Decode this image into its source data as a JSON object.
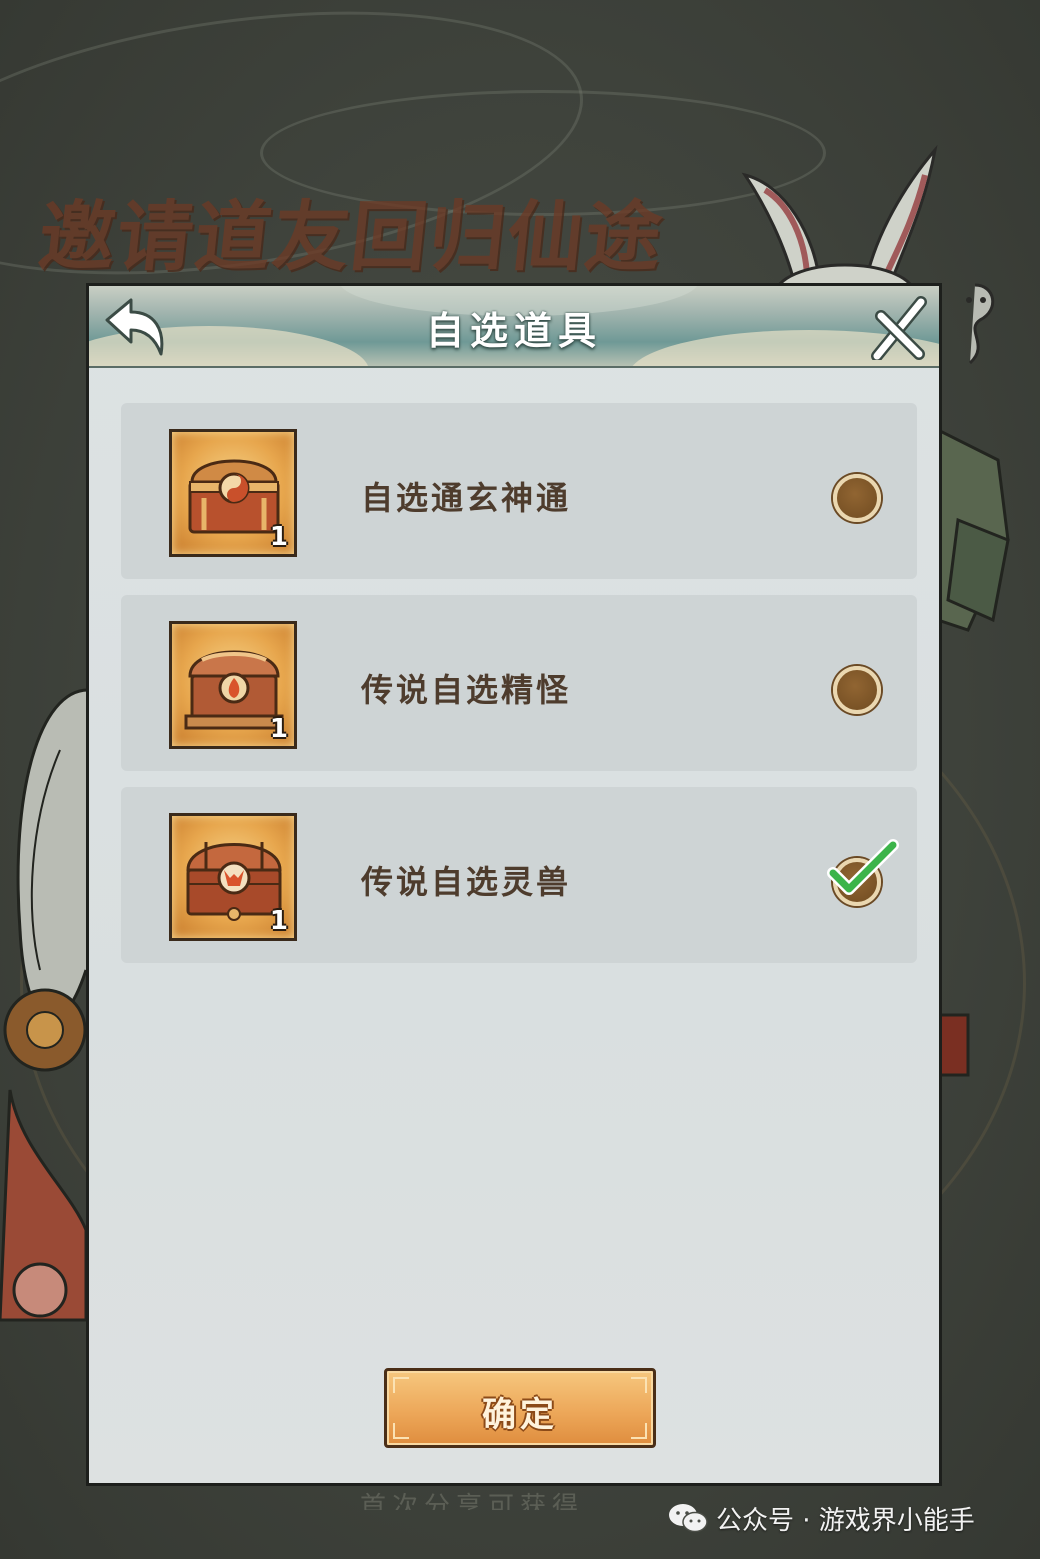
{
  "background": {
    "event_title": "邀请道友回归仙途",
    "footer_text": "首次分享可获得"
  },
  "dialog": {
    "title": "自选道具",
    "back_icon": "back-arrow-icon",
    "close_icon": "close-x-icon",
    "items": [
      {
        "name": "自选通玄神通",
        "count": "1",
        "icon": "yin-yang-chest-icon",
        "selected": false
      },
      {
        "name": "传说自选精怪",
        "count": "1",
        "icon": "flame-chest-icon",
        "selected": false
      },
      {
        "name": "传说自选灵兽",
        "count": "1",
        "icon": "fox-chest-icon",
        "selected": true
      }
    ],
    "confirm_label": "确定"
  },
  "watermark": {
    "text": "公众号 · 游戏界小能手"
  },
  "colors": {
    "overlay": "#3f433c",
    "dialog_bg": "#dde2e3",
    "row_bg": "#ced4d5",
    "radio": "#7a5326",
    "check": "#3cb44a",
    "button": "#eda85a",
    "item_text": "#4e3c2d"
  }
}
